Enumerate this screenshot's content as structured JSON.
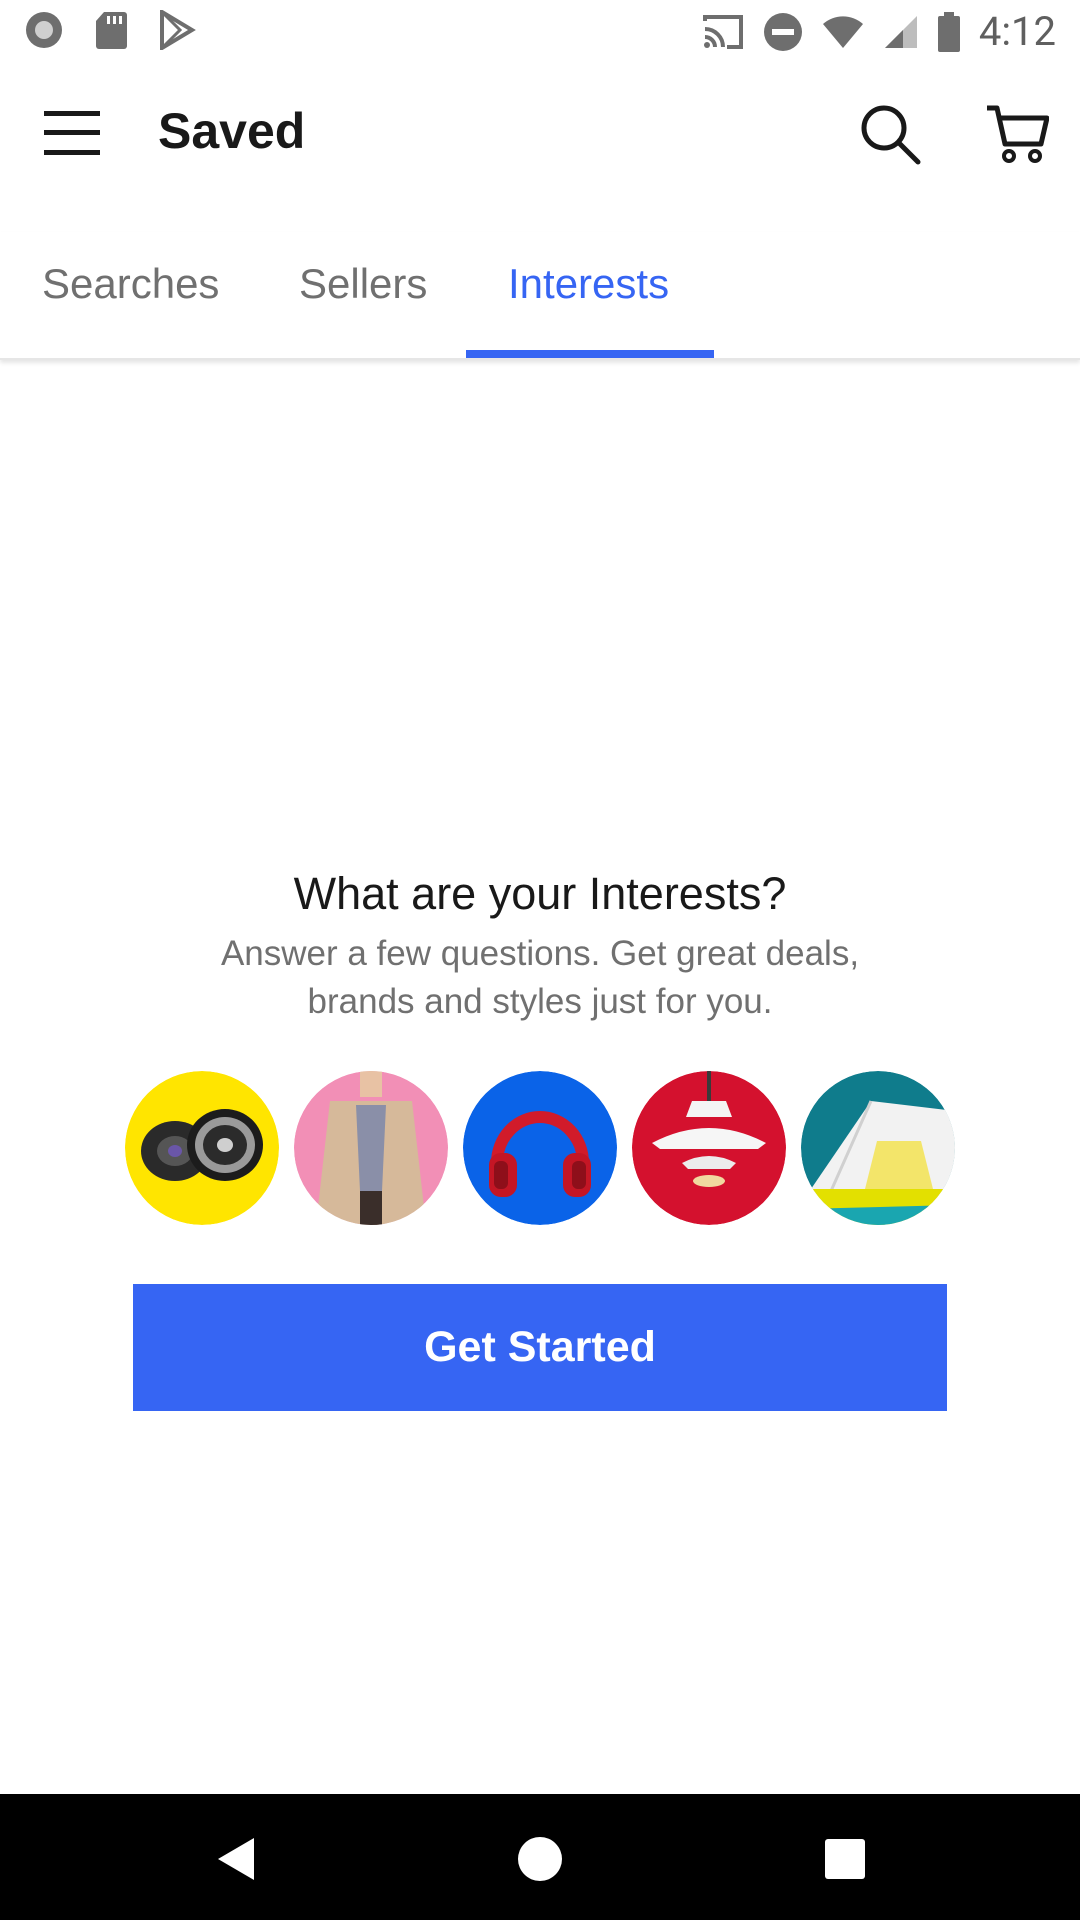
{
  "status_bar": {
    "time": "4:12",
    "left_icons": [
      "record-icon",
      "sd-card-icon",
      "play-store-icon"
    ],
    "right_icons": [
      "cast-icon",
      "do-not-disturb-icon",
      "wifi-icon",
      "signal-icon",
      "battery-icon"
    ]
  },
  "header": {
    "title": "Saved",
    "menu_icon": "hamburger-menu-icon",
    "search_icon": "search-icon",
    "cart_icon": "cart-icon"
  },
  "tabs": [
    {
      "label": "Searches",
      "active": false
    },
    {
      "label": "Sellers",
      "active": false
    },
    {
      "label": "Interests",
      "active": true
    }
  ],
  "interests": {
    "heading": "What are your Interests?",
    "subtitle": "Answer a few questions. Get great deals, brands and styles just for you.",
    "categories": [
      {
        "name": "speakers",
        "color": "#FFE500"
      },
      {
        "name": "fashion-coat",
        "color": "#F28FB6"
      },
      {
        "name": "headphones",
        "color": "#0A63E8"
      },
      {
        "name": "lamp",
        "color": "#D4112E"
      },
      {
        "name": "tent",
        "color": "#0F7C8C"
      }
    ],
    "cta_label": "Get Started"
  },
  "colors": {
    "accent": "#3665f3",
    "text_primary": "#191919",
    "text_secondary": "#707070"
  },
  "nav_bar": {
    "icons": [
      "back-icon",
      "home-icon",
      "recents-icon"
    ]
  }
}
